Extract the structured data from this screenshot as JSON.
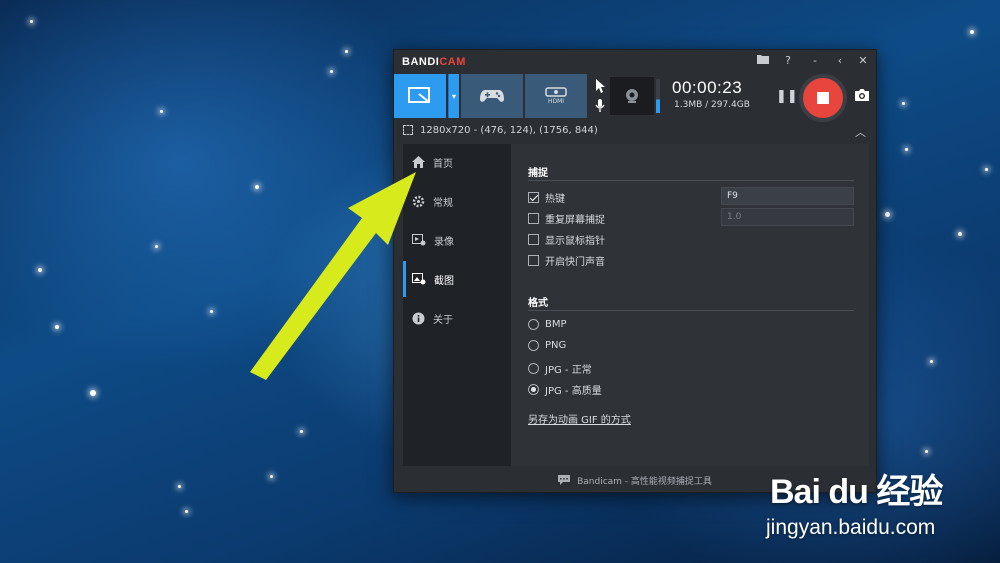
{
  "app": {
    "brand_a": "BANDI",
    "brand_b": "CAM"
  },
  "titlebar": {
    "help": "?",
    "minimize": "-",
    "close": "✕"
  },
  "toolbar": {
    "modes": [
      "screen-rectangle-mode",
      "game-mode",
      "device-mode"
    ],
    "hdmi_label": "HDMI",
    "timer": "00:00:23",
    "size": "1.3MB / 297.4GB",
    "pause": "❚❚"
  },
  "region": {
    "text": "1280x720 - (476, 124), (1756, 844)"
  },
  "sidebar": {
    "items": [
      {
        "label": "首页",
        "icon": "home-icon"
      },
      {
        "label": "常规",
        "icon": "gear-icon"
      },
      {
        "label": "录像",
        "icon": "video-icon"
      },
      {
        "label": "截图",
        "icon": "image-icon",
        "active": true
      },
      {
        "label": "关于",
        "icon": "info-icon"
      }
    ]
  },
  "capture": {
    "title": "捕捉",
    "options": [
      {
        "label": "热键",
        "checked": true
      },
      {
        "label": "重复屏幕捕捉",
        "checked": false
      },
      {
        "label": "显示鼠标指针",
        "checked": false
      },
      {
        "label": "开启快门声音",
        "checked": false
      }
    ],
    "hotkey_value": "F9",
    "repeat_value": "1.0"
  },
  "format": {
    "title": "格式",
    "options": [
      {
        "label": "BMP",
        "selected": false
      },
      {
        "label": "PNG",
        "selected": false
      },
      {
        "label": "JPG - 正常",
        "selected": false
      },
      {
        "label": "JPG - 高质量",
        "selected": true
      }
    ],
    "gif_link": "另存为动画 GIF 的方式"
  },
  "footer": {
    "text": "Bandicam - 高性能视频捕捉工具"
  },
  "watermark": {
    "logo": "Bai du 经验",
    "url": "jingyan.baidu.com"
  },
  "colors": {
    "accent": "#2d9cf0",
    "record": "#e8453c",
    "arrow": "#d7ea1c"
  }
}
